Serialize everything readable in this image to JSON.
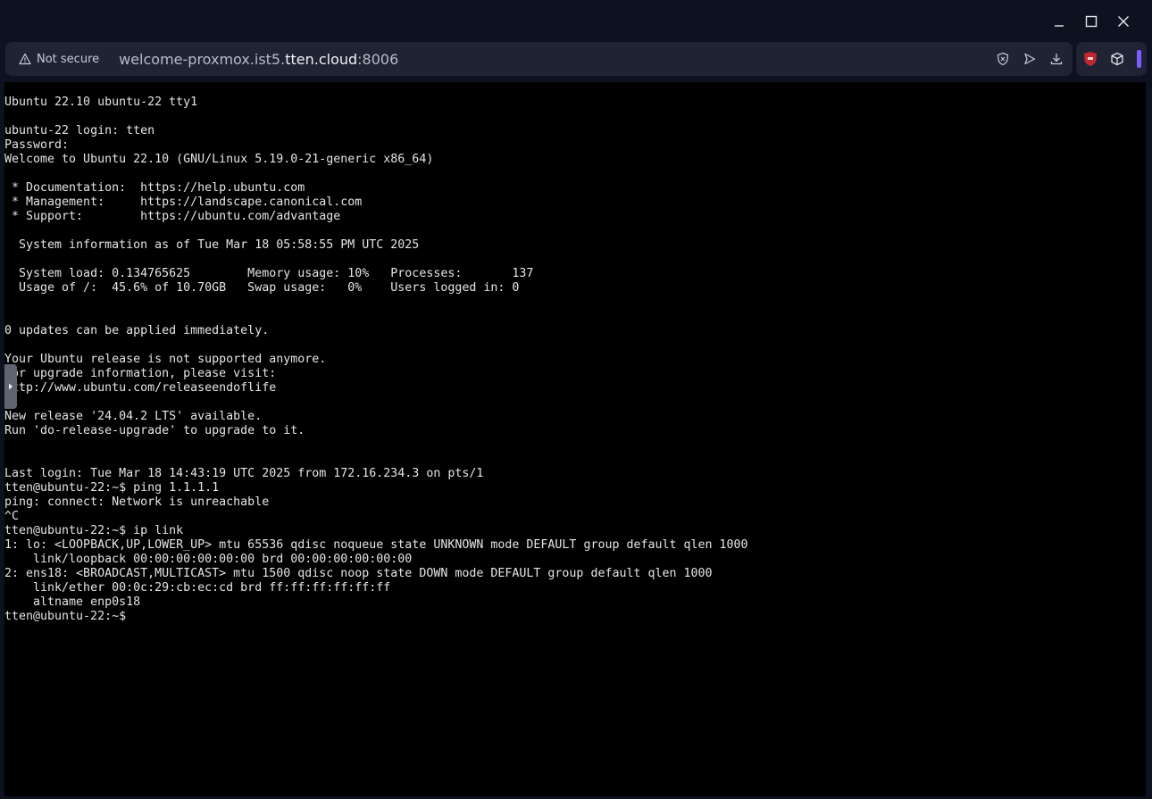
{
  "window": {
    "controls": {
      "minimize_icon": "minimize-icon",
      "maximize_icon": "maximize-icon",
      "close_icon": "close-icon"
    }
  },
  "address_bar": {
    "security_label": "Not secure",
    "url_prefix": "welcome-proxmox.ist5.",
    "url_domain": "tten.cloud",
    "url_suffix": ":8006"
  },
  "colors": {
    "page_background": "#0e1120",
    "bar_background": "#1f2333",
    "terminal_background": "#000000",
    "terminal_text": "#e5e5e5",
    "extension_accent": "#7b5cff",
    "ublock_red": "#c0282f"
  },
  "terminal": {
    "lines": [
      "Ubuntu 22.10 ubuntu-22 tty1",
      "",
      "ubuntu-22 login: tten",
      "Password:",
      "Welcome to Ubuntu 22.10 (GNU/Linux 5.19.0-21-generic x86_64)",
      "",
      " * Documentation:  https://help.ubuntu.com",
      " * Management:     https://landscape.canonical.com",
      " * Support:        https://ubuntu.com/advantage",
      "",
      "  System information as of Tue Mar 18 05:58:55 PM UTC 2025",
      "",
      "  System load: 0.134765625        Memory usage: 10%   Processes:       137",
      "  Usage of /:  45.6% of 10.70GB   Swap usage:   0%    Users logged in: 0",
      "",
      "",
      "0 updates can be applied immediately.",
      "",
      "Your Ubuntu release is not supported anymore.",
      "For upgrade information, please visit:",
      "http://www.ubuntu.com/releaseendoflife",
      "",
      "New release '24.04.2 LTS' available.",
      "Run 'do-release-upgrade' to upgrade to it.",
      "",
      "",
      "Last login: Tue Mar 18 14:43:19 UTC 2025 from 172.16.234.3 on pts/1",
      "tten@ubuntu-22:~$ ping 1.1.1.1",
      "ping: connect: Network is unreachable",
      "^C",
      "tten@ubuntu-22:~$ ip link",
      "1: lo: <LOOPBACK,UP,LOWER_UP> mtu 65536 qdisc noqueue state UNKNOWN mode DEFAULT group default qlen 1000",
      "    link/loopback 00:00:00:00:00:00 brd 00:00:00:00:00:00",
      "2: ens18: <BROADCAST,MULTICAST> mtu 1500 qdisc noop state DOWN mode DEFAULT group default qlen 1000",
      "    link/ether 00:0c:29:cb:ec:cd brd ff:ff:ff:ff:ff:ff",
      "    altname enp0s18",
      "tten@ubuntu-22:~$"
    ]
  }
}
